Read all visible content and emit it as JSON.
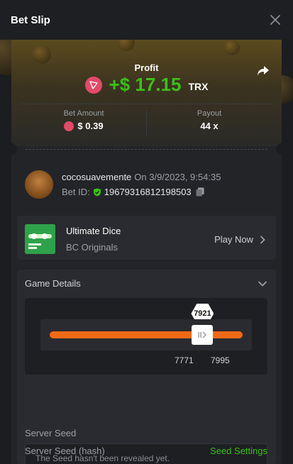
{
  "header": {
    "title": "Bet Slip",
    "close_icon": "close-icon"
  },
  "profit": {
    "label": "Profit",
    "value": "+$ 17.15",
    "currency": "TRX",
    "share_icon": "share-icon"
  },
  "stats": {
    "bet_amount_label": "Bet Amount",
    "bet_amount_value": "$ 0.39",
    "payout_label": "Payout",
    "payout_value": "44 x"
  },
  "user": {
    "username": "cocosuavemente",
    "date": "On 3/9/2023, 9:54:35",
    "bet_id_label": "Bet ID:",
    "bet_id": "19679316812198503"
  },
  "game": {
    "title": "Ultimate Dice",
    "subtitle": "BC Originals",
    "play_label": "Play Now"
  },
  "details": {
    "title": "Game Details",
    "result": "7921",
    "range_low": "7771",
    "range_high": "7995",
    "result_fraction": 0.7921,
    "server_seed_label": "Server Seed",
    "server_seed_placeholder": "The Seed hasn't been revealed yet.",
    "server_seed_hash_label": "Server Seed (hash)",
    "seed_settings_label": "Seed Settings"
  },
  "colors": {
    "accent_green": "#3bc117",
    "slider_orange": "#f06a16",
    "trx_red": "#e24a68"
  }
}
